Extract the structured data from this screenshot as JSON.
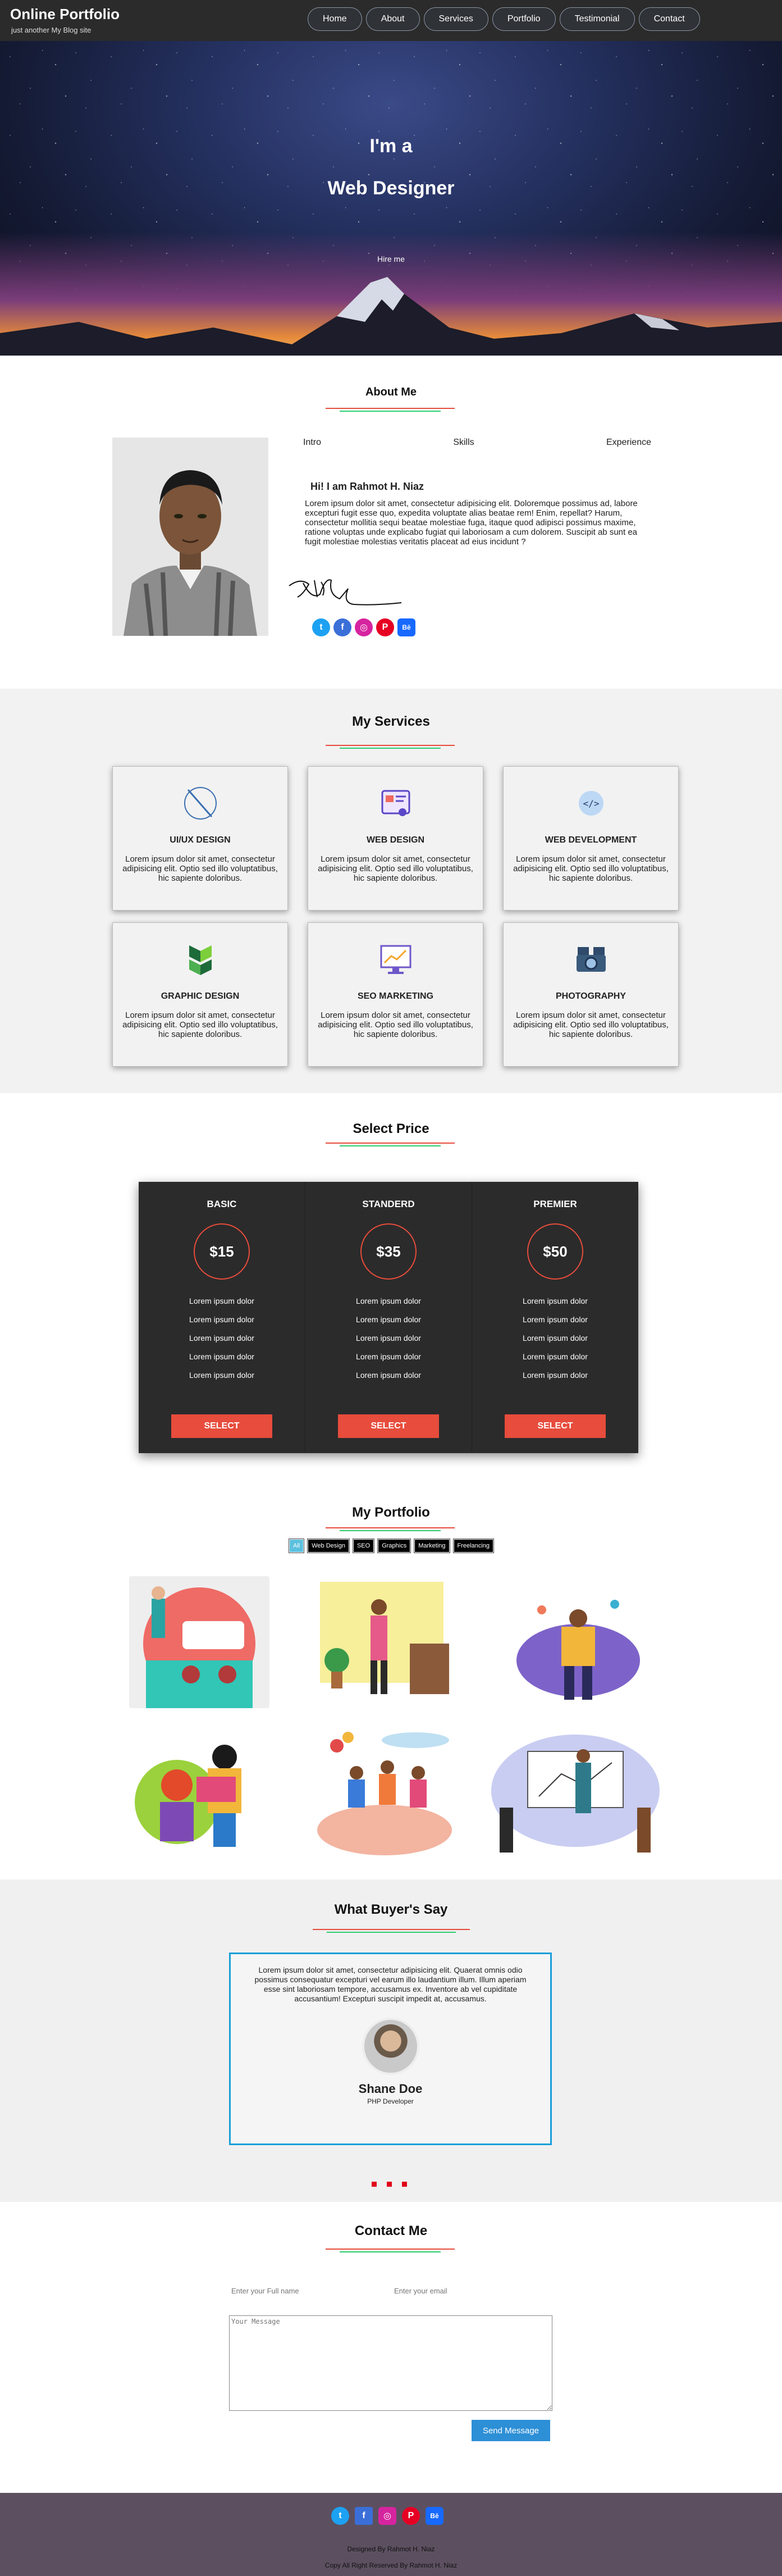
{
  "header": {
    "logo": "Online Portfolio",
    "tagline": "just another My Blog site",
    "nav": [
      "Home",
      "About",
      "Services",
      "Portfolio",
      "Testimonial",
      "Contact"
    ]
  },
  "hero": {
    "line1": "I'm a",
    "line2": "Web Designer",
    "cta": "Hire me"
  },
  "about": {
    "title": "About Me",
    "tabs": [
      "Intro",
      "Skills",
      "Experience"
    ],
    "greeting": "Hi! I am Rahmot H. Niaz",
    "text": "Lorem ipsum dolor sit amet, consectetur adipisicing elit. Doloremque possimus ad, labore excepturi fugit esse quo, expedita voluptate alias beatae rem! Enim, repellat? Harum, consectetur mollitia sequi beatae molestiae fuga, itaque quod adipisci possimus maxime, ratione voluptas unde explicabo fugiat qui laboriosam a cum dolorem. Suscipit ab sunt ea fugit molestiae molestias veritatis placeat ad eius incidunt ?",
    "social": [
      "twitter-icon",
      "facebook-icon",
      "instagram-icon",
      "pinterest-icon",
      "behance-icon"
    ]
  },
  "services": {
    "title": "My Services",
    "items": [
      {
        "name": "UI/UX DESIGN",
        "text": "Lorem ipsum dolor sit amet, consectetur adipisicing elit. Optio sed illo voluptatibus, hic sapiente doloribus."
      },
      {
        "name": "WEB DESIGN",
        "text": "Lorem ipsum dolor sit amet, consectetur adipisicing elit. Optio sed illo voluptatibus, hic sapiente doloribus."
      },
      {
        "name": "WEB DEVELOPMENT",
        "text": "Lorem ipsum dolor sit amet, consectetur adipisicing elit. Optio sed illo voluptatibus, hic sapiente doloribus."
      },
      {
        "name": "GRAPHIC DESIGN",
        "text": "Lorem ipsum dolor sit amet, consectetur adipisicing elit. Optio sed illo voluptatibus, hic sapiente doloribus."
      },
      {
        "name": "SEO MARKETING",
        "text": "Lorem ipsum dolor sit amet, consectetur adipisicing elit. Optio sed illo voluptatibus, hic sapiente doloribus."
      },
      {
        "name": "PHOTOGRAPHY",
        "text": "Lorem ipsum dolor sit amet, consectetur adipisicing elit. Optio sed illo voluptatibus, hic sapiente doloribus."
      }
    ]
  },
  "price": {
    "title": "Select Price",
    "plans": [
      {
        "name": "BASIC",
        "price": "$15",
        "features": [
          "Lorem ipsum dolor",
          "Lorem ipsum dolor",
          "Lorem ipsum dolor",
          "Lorem ipsum dolor",
          "Lorem ipsum dolor"
        ],
        "button": "SELECT"
      },
      {
        "name": "STANDERD",
        "price": "$35",
        "features": [
          "Lorem ipsum dolor",
          "Lorem ipsum dolor",
          "Lorem ipsum dolor",
          "Lorem ipsum dolor",
          "Lorem ipsum dolor"
        ],
        "button": "SELECT"
      },
      {
        "name": "PREMIER",
        "price": "$50",
        "features": [
          "Lorem ipsum dolor",
          "Lorem ipsum dolor",
          "Lorem ipsum dolor",
          "Lorem ipsum dolor",
          "Lorem ipsum dolor"
        ],
        "button": "SELECT"
      }
    ]
  },
  "portfolio": {
    "title": "My Portfolio",
    "filters": [
      "All",
      "Web Design",
      "SEO",
      "Graphics",
      "Marketing",
      "Freelancing"
    ]
  },
  "testimonial": {
    "title": "What Buyer's Say",
    "text": "Lorem ipsum dolor sit amet, consectetur adipisicing elit. Quaerat omnis odio possimus consequatur excepturi vel earum illo laudantium illum. Illum aperiam esse sint laboriosam tempore, accusamus ex. Inventore ab vel cupiditate accusantium! Excepturi suscipit impedit at, accusamus.",
    "name": "Shane Doe",
    "role": "PHP Developer"
  },
  "contact": {
    "title": "Contact Me",
    "name_placeholder": "Enter your Full name",
    "email_placeholder": "Enter your email",
    "message_placeholder": "Your Message",
    "send": "Send Message"
  },
  "footer": {
    "designed": "Designed By Rahmot H. Niaz",
    "copyright": "Copy All Right Reserved By Rahmot H. Niaz"
  },
  "colors": {
    "accent_red": "#e74c3c",
    "accent_green": "#2ecc71",
    "accent_blue": "#1a9fd8"
  }
}
